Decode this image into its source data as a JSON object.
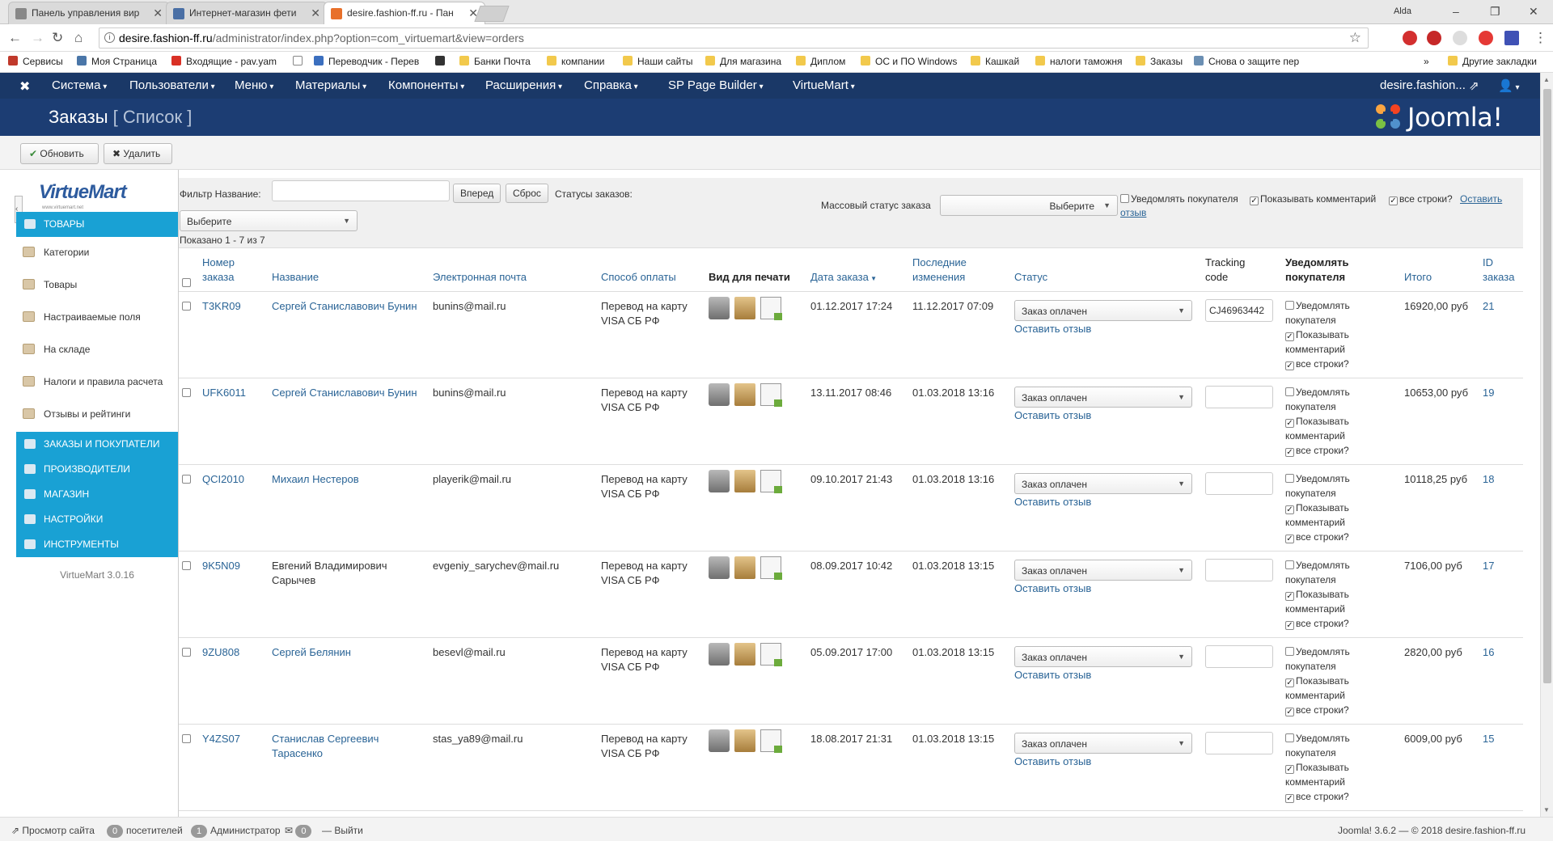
{
  "browser": {
    "tabs": [
      {
        "label": "Панель управления вир"
      },
      {
        "label": "Интернет-магазин фети"
      },
      {
        "label": "desire.fashion-ff.ru - Пан"
      }
    ],
    "user": "Alda",
    "url_host": "desire.fashion-ff.ru",
    "url_path": "/administrator/index.php?option=com_virtuemart&view=orders",
    "bookmarks": [
      "Сервисы",
      "Моя Страница",
      "Входящие - pav.yam",
      "Переводчик - Перев",
      "Банки Почта",
      "компании",
      "Наши сайты",
      "Для магазина",
      "Диплом",
      "ОС и ПО Windows",
      "Кашкай",
      "налоги таможня",
      "Заказы",
      "Снова о защите пер"
    ],
    "other_bookmarks": "Другие закладки"
  },
  "topnav": {
    "items": [
      "Система",
      "Пользователи",
      "Меню",
      "Материалы",
      "Компоненты",
      "Расширения",
      "Справка",
      "SP Page Builder",
      "VirtueMart"
    ],
    "site": "desire.fashion..."
  },
  "header": {
    "title": "Заказы",
    "subtitle": "[ Список ]",
    "logo_text": "Joomla!"
  },
  "toolbar": {
    "refresh": "Обновить",
    "delete": "Удалить"
  },
  "sidebar": {
    "logo": "VirtueMart",
    "logo_tagline": "www.virtuemart.net",
    "head_products": "ТОВАРЫ",
    "items": [
      "Категории",
      "Товары",
      "Настраиваемые поля",
      "На складе",
      "Налоги и правила расчета",
      "Отзывы и рейтинги"
    ],
    "heads": [
      "ЗАКАЗЫ И ПОКУПАТЕЛИ",
      "ПРОИЗВОДИТЕЛИ",
      "МАГАЗИН",
      "НАСТРОЙКИ",
      "ИНСТРУМЕНТЫ"
    ],
    "version": "VirtueMart 3.0.16"
  },
  "filter": {
    "name_label": "Фильтр Название:",
    "name_value": "",
    "go": "Вперед",
    "reset": "Сброс",
    "status_label": "Статусы заказов:",
    "status_select": "Выберите",
    "mass_label": "Массовый статус заказа",
    "mass_select": "Выберите",
    "notify": "Уведомлять покупателя",
    "show_comment": "Показывать комментарий",
    "all_rows": "все строки?",
    "leave": "Оставить",
    "leave2": "отзыв",
    "shown": "Показано 1 - 7 из 7"
  },
  "columns": {
    "number": [
      "Номер",
      "заказа"
    ],
    "name": "Название",
    "email": "Электронная почта",
    "payment": "Способ оплаты",
    "print": "Вид для печати",
    "date": "Дата заказа",
    "modified": [
      "Последние",
      "изменения"
    ],
    "status": "Статус",
    "tracking": [
      "Tracking",
      "code"
    ],
    "notify": [
      "Уведомлять",
      "покупателя"
    ],
    "total": "Итого",
    "id": [
      "ID",
      "заказа"
    ]
  },
  "row_labels": {
    "leave_review": "Оставить отзыв",
    "notify": [
      "Уведомлять",
      "покупателя"
    ],
    "show": [
      "Показывать",
      "комментарий"
    ],
    "all": "все строки?"
  },
  "orders": [
    {
      "number": "T3KR09",
      "name": [
        "Сергей Станиславович Бунин"
      ],
      "name_link": true,
      "email": "bunins@mail.ru",
      "payment": [
        "Перевод на карту",
        "VISA СБ РФ"
      ],
      "date": "01.12.2017 17:24",
      "modified": "11.12.2017 07:09",
      "status": "Заказ оплачен",
      "tracking": "CJ46963442",
      "total": "16920,00 руб",
      "id": "21"
    },
    {
      "number": "UFK6011",
      "name": [
        "Сергей Станиславович Бунин"
      ],
      "name_link": true,
      "email": "bunins@mail.ru",
      "payment": [
        "Перевод на карту",
        "VISA СБ РФ"
      ],
      "date": "13.11.2017 08:46",
      "modified": "01.03.2018 13:16",
      "status": "Заказ оплачен",
      "tracking": "",
      "total": "10653,00 руб",
      "id": "19"
    },
    {
      "number": "QCI2010",
      "name": [
        "Михаил Нестеров"
      ],
      "name_link": true,
      "email": "playerik@mail.ru",
      "payment": [
        "Перевод на карту",
        "VISA СБ РФ"
      ],
      "date": "09.10.2017 21:43",
      "modified": "01.03.2018 13:16",
      "status": "Заказ оплачен",
      "tracking": "",
      "total": "10118,25 руб",
      "id": "18"
    },
    {
      "number": "9K5N09",
      "name": [
        "Евгений Владимирович",
        "Сарычев"
      ],
      "name_link": false,
      "email": "evgeniy_sarychev@mail.ru",
      "payment": [
        "Перевод на карту",
        "VISA СБ РФ"
      ],
      "date": "08.09.2017 10:42",
      "modified": "01.03.2018 13:15",
      "status": "Заказ оплачен",
      "tracking": "",
      "total": "7106,00 руб",
      "id": "17"
    },
    {
      "number": "9ZU808",
      "name": [
        "Сергей Белянин"
      ],
      "name_link": true,
      "email": "besevl@mail.ru",
      "payment": [
        "Перевод на карту",
        "VISA СБ РФ"
      ],
      "date": "05.09.2017 17:00",
      "modified": "01.03.2018 13:15",
      "status": "Заказ оплачен",
      "tracking": "",
      "total": "2820,00 руб",
      "id": "16"
    },
    {
      "number": "Y4ZS07",
      "name": [
        "Станислав Сергеевич",
        "Тарасенко"
      ],
      "name_link": true,
      "email": "stas_ya89@mail.ru",
      "payment": [
        "Перевод на карту",
        "VISA СБ РФ"
      ],
      "date": "18.08.2017 21:31",
      "modified": "01.03.2018 13:15",
      "status": "Заказ оплачен",
      "tracking": "",
      "total": "6009,00 руб",
      "id": "15"
    }
  ],
  "status": {
    "view_site": "Просмотр сайта",
    "visitors_count": "0",
    "visitors": "посетителей",
    "admins_count": "1",
    "admins": "Администратор",
    "messages_count": "0",
    "logout": "Выйти",
    "copyright": "Joomla! 3.6.2 — © 2018 desire.fashion-ff.ru"
  },
  "colors": {
    "nav": "#1a3867",
    "header": "#1c3d73",
    "sidebar_accent": "#19a1d4",
    "link": "#2a6496"
  }
}
